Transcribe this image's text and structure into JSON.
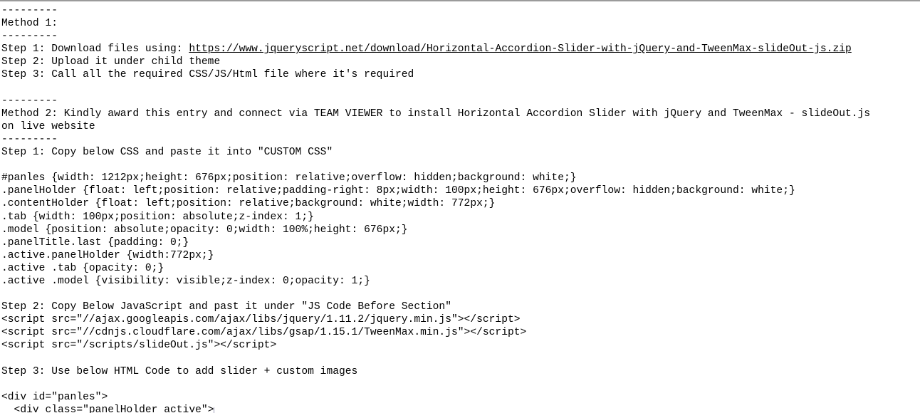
{
  "document": {
    "font_color": "#000000",
    "background": "#ffffff",
    "top_border_color": "#9b9b9b",
    "link_color": "#000000",
    "lines": [
      {
        "id": "sep-1",
        "text": "---------"
      },
      {
        "id": "method-1-heading",
        "text": "Method 1:"
      },
      {
        "id": "sep-2",
        "text": "---------"
      },
      {
        "id": "m1-step-1-prefix",
        "text": "Step 1: Download files using: "
      },
      {
        "id": "m1-step-2",
        "text": "Step 2: Upload it under child theme"
      },
      {
        "id": "m1-step-3",
        "text": "Step 3: Call all the required CSS/JS/Html file where it's required"
      },
      {
        "id": "blank-1",
        "text": ""
      },
      {
        "id": "sep-3",
        "text": "---------"
      },
      {
        "id": "method-2-heading",
        "text": "Method 2: Kindly award this entry and connect via TEAM VIEWER to install Horizontal Accordion Slider with jQuery and TweenMax - slideOut.js"
      },
      {
        "id": "method-2-heading-cont",
        "text": "on live website"
      },
      {
        "id": "sep-4",
        "text": "---------"
      },
      {
        "id": "m2-step-1",
        "text": "Step 1: Copy below CSS and paste it into \"CUSTOM CSS\""
      },
      {
        "id": "blank-2",
        "text": ""
      },
      {
        "id": "css-1",
        "text": "#panles {width: 1212px;height: 676px;position: relative;overflow: hidden;background: white;}"
      },
      {
        "id": "css-2",
        "text": ".panelHolder {float: left;position: relative;padding-right: 8px;width: 100px;height: 676px;overflow: hidden;background: white;}"
      },
      {
        "id": "css-3",
        "text": ".contentHolder {float: left;position: relative;background: white;width: 772px;}"
      },
      {
        "id": "css-4",
        "text": ".tab {width: 100px;position: absolute;z-index: 1;}"
      },
      {
        "id": "css-5",
        "text": ".model {position: absolute;opacity: 0;width: 100%;height: 676px;}"
      },
      {
        "id": "css-6",
        "text": ".panelTitle.last {padding: 0;}"
      },
      {
        "id": "css-7",
        "text": ".active.panelHolder {width:772px;}"
      },
      {
        "id": "css-8",
        "text": ".active .tab {opacity: 0;}"
      },
      {
        "id": "css-9",
        "text": ".active .model {visibility: visible;z-index: 0;opacity: 1;}"
      },
      {
        "id": "blank-3",
        "text": ""
      },
      {
        "id": "m2-step-2",
        "text": "Step 2: Copy Below JavaScript and past it under \"JS Code Before Section\""
      },
      {
        "id": "js-1",
        "text": "<script src=\"//ajax.googleapis.com/ajax/libs/jquery/1.11.2/jquery.min.js\"></script>"
      },
      {
        "id": "js-2",
        "text": "<script src=\"//cdnjs.cloudflare.com/ajax/libs/gsap/1.15.1/TweenMax.min.js\"></script>"
      },
      {
        "id": "js-3",
        "text": "<script src=\"/scripts/slideOut.js\"></script>"
      },
      {
        "id": "blank-4",
        "text": ""
      },
      {
        "id": "m2-step-3",
        "text": "Step 3: Use below HTML Code to add slider + custom images"
      },
      {
        "id": "blank-5",
        "text": ""
      },
      {
        "id": "html-1",
        "text": "<div id=\"panles\">"
      },
      {
        "id": "html-2",
        "text": "  <div class=\"panelHolder active\">"
      }
    ],
    "download_link": {
      "text": "https://www.jqueryscript.net/download/Horizontal-Accordion-Slider-with-jQuery-and-TweenMax-slideOut-js.zip",
      "href": "https://www.jqueryscript.net/download/Horizontal-Accordion-Slider-with-jQuery-and-TweenMax-slideOut-js.zip"
    }
  }
}
